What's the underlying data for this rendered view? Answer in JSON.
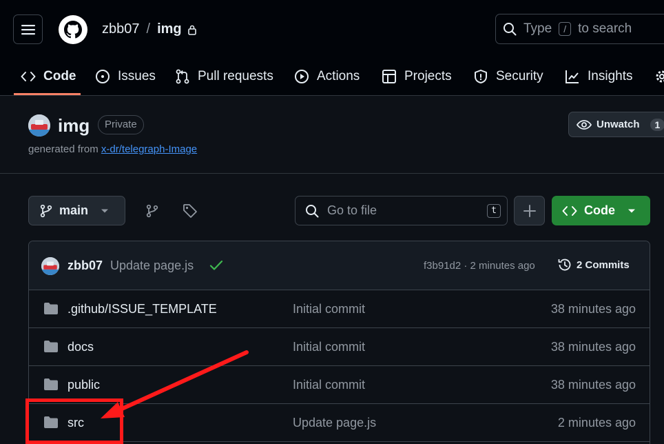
{
  "header": {
    "owner": "zbb07",
    "separator": "/",
    "repo": "img",
    "search_prefix": "Type",
    "search_key": "/",
    "search_suffix": "to search"
  },
  "nav_tabs": [
    {
      "label": "Code",
      "icon": "code-icon",
      "active": true
    },
    {
      "label": "Issues",
      "icon": "issue-icon"
    },
    {
      "label": "Pull requests",
      "icon": "pull-request-icon"
    },
    {
      "label": "Actions",
      "icon": "play-icon"
    },
    {
      "label": "Projects",
      "icon": "table-icon"
    },
    {
      "label": "Security",
      "icon": "shield-icon"
    },
    {
      "label": "Insights",
      "icon": "graph-icon"
    }
  ],
  "repo_header": {
    "name": "img",
    "visibility": "Private",
    "generated_prefix": "generated from",
    "template_link": "x-dr/telegraph-Image",
    "watch_label": "Unwatch",
    "watch_count": "1"
  },
  "toolbar": {
    "branch": "main",
    "goto_placeholder": "Go to file",
    "goto_key": "t",
    "code_label": "Code"
  },
  "latest_commit": {
    "author": "zbb07",
    "message": "Update page.js",
    "meta": "f3b91d2 · 2 minutes ago",
    "commits_label": "2 Commits"
  },
  "files": [
    {
      "name": ".github/ISSUE_TEMPLATE",
      "message": "Initial commit",
      "age": "38 minutes ago"
    },
    {
      "name": "docs",
      "message": "Initial commit",
      "age": "38 minutes ago"
    },
    {
      "name": "public",
      "message": "Initial commit",
      "age": "38 minutes ago"
    },
    {
      "name": "src",
      "message": "Update page.js",
      "age": "2 minutes ago"
    }
  ],
  "colors": {
    "background": "#0d1117",
    "header_bg": "#010409",
    "accent_green": "#238636",
    "link_blue": "#4493f8",
    "tab_underline": "#f78166",
    "annotation_red": "#ff1a1a"
  }
}
